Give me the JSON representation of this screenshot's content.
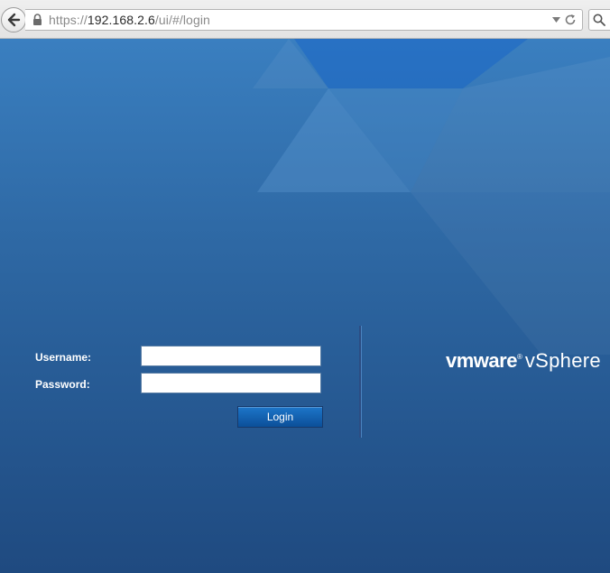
{
  "browser": {
    "url_scheme": "https://",
    "url_host": "192.168.2.6",
    "url_path": "/ui/#/login"
  },
  "login": {
    "username_label": "Username:",
    "password_label": "Password:",
    "username_value": "",
    "password_value": "",
    "button_label": "Login"
  },
  "brand": {
    "vm": "vm",
    "ware": "ware",
    "registered": "®",
    "product": "vSphere"
  },
  "colors": {
    "page_top": "#3a7fc0",
    "page_bottom": "#1f4a80",
    "button": "#0b5aa8",
    "text": "#ffffff"
  }
}
